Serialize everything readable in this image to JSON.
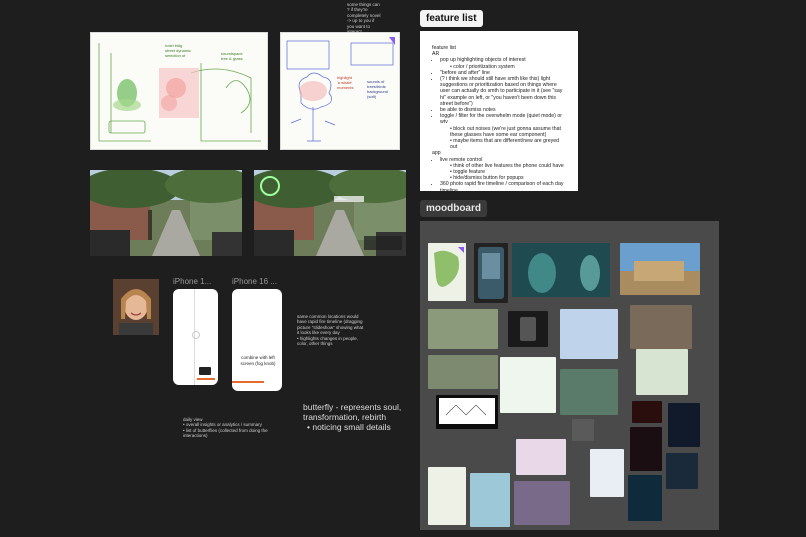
{
  "top_note": {
    "lines": [
      "some things can",
      "? if they're",
      "completely novel",
      "-> up to you if",
      "you want to",
      "interact"
    ]
  },
  "feature_list": {
    "chip": "feature list",
    "doc": {
      "heading": "feature list",
      "ar_label": "AR",
      "ar_items": [
        {
          "text": "pop up highlighting objects of interest",
          "sub": [
            "color / prioritization system"
          ]
        },
        {
          "text": "\"before and after\" line",
          "sub": []
        },
        {
          "text": "(? i think we should still have smth like this) light suggestions or prioritization based on things where user can actually do smth to participate in it (see \"say hi\" example on left, or \"you haven't been down this street before\")",
          "sub": []
        },
        {
          "text": "be able to dismiss notes",
          "sub": []
        },
        {
          "text": "toggle / filter for the overwhelm mode (quiet mode) or wtv",
          "sub": [
            "block out noises (we're just gonna assume that these glasses have some ear component)",
            "maybe items that are different/new are greyed out"
          ]
        }
      ],
      "app_label": "app",
      "app_items": [
        {
          "text": "live remote control",
          "sub": [
            "think of other live features the phone could have",
            "toggle feature",
            "hide/dismiss button for popups"
          ]
        },
        {
          "text": "360 photo rapid fire timeline / comparison of each day",
          "sub": []
        },
        {
          "text": "timeline",
          "sub": []
        },
        {
          "text": "summary/analytics",
          "sub": []
        }
      ]
    }
  },
  "moodboard": {
    "chip": "moodboard",
    "caption": "..."
  },
  "phones": {
    "label_1": "iPhone 1...",
    "label_2": "iPhone 16 ...",
    "phone2_caption": "combine with left screen (fog knob)"
  },
  "notes": {
    "timeline_note": [
      "same common locations would",
      "have rapid fire timeline (dragging",
      "picture \"slideshow\" showing what",
      "it looks like every day",
      "• highlights changes in people,",
      "  color, other things"
    ],
    "daily_view": [
      "daily view",
      "• overall insights or analytics / summary",
      "• list of butterflies (collected from doing the interactions)"
    ]
  },
  "butterfly": {
    "line1": "butterfly - represents soul,",
    "line2": "transformation, rebirth",
    "bullet": "noticing small details"
  },
  "sketch_labels": {
    "left": [
      "hotel bldg",
      "street dynamic",
      "selection of",
      "soundspace",
      "tree & grass"
    ],
    "right": [
      "highlight",
      "'a whale'",
      "moments",
      "sounds of",
      "trees/birds",
      "background",
      "(soft)"
    ]
  },
  "colors": {
    "canvas": "#1e1e1e",
    "moodboard_bg": "#4a4a4a",
    "accent_purple": "#8a5cf6"
  }
}
